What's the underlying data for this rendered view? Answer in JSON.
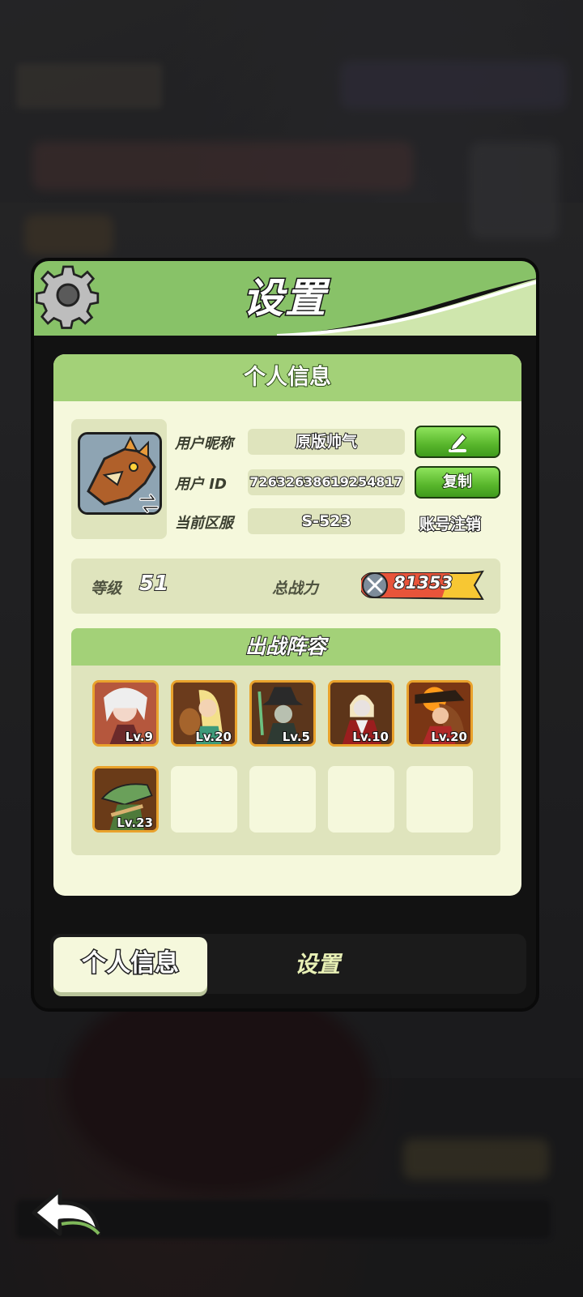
{
  "dialog": {
    "title": "设置"
  },
  "personal_info": {
    "section_title": "个人信息",
    "nickname_label": "用户昵称",
    "nickname_value": "原版帅气",
    "user_id_label": "用户 ID",
    "user_id_value": "72632638619254817",
    "copy_label": "复制",
    "server_label": "当前区服",
    "server_value": "S-523",
    "cancel_account_label": "账号注销"
  },
  "stats": {
    "level_label": "等级",
    "level_value": "51",
    "power_label": "总战力",
    "power_value": "81353"
  },
  "lineup": {
    "title": "出战阵容",
    "heroes": [
      {
        "level": "Lv.9"
      },
      {
        "level": "Lv.20"
      },
      {
        "level": "Lv.5"
      },
      {
        "level": "Lv.10"
      },
      {
        "level": "Lv.20"
      },
      {
        "level": "Lv.23"
      }
    ]
  },
  "tabs": [
    {
      "label": "个人信息",
      "active": true
    },
    {
      "label": "设置",
      "active": false
    }
  ],
  "colors": {
    "header_green": "#a3d178",
    "panel_bg": "#f5f8dc",
    "button_green": "#58b62b",
    "hero_frame": "#e9a22c"
  },
  "icons": [
    "gear-icon",
    "swap-icon",
    "edit-icon",
    "power-icon",
    "back-arrow-icon"
  ]
}
